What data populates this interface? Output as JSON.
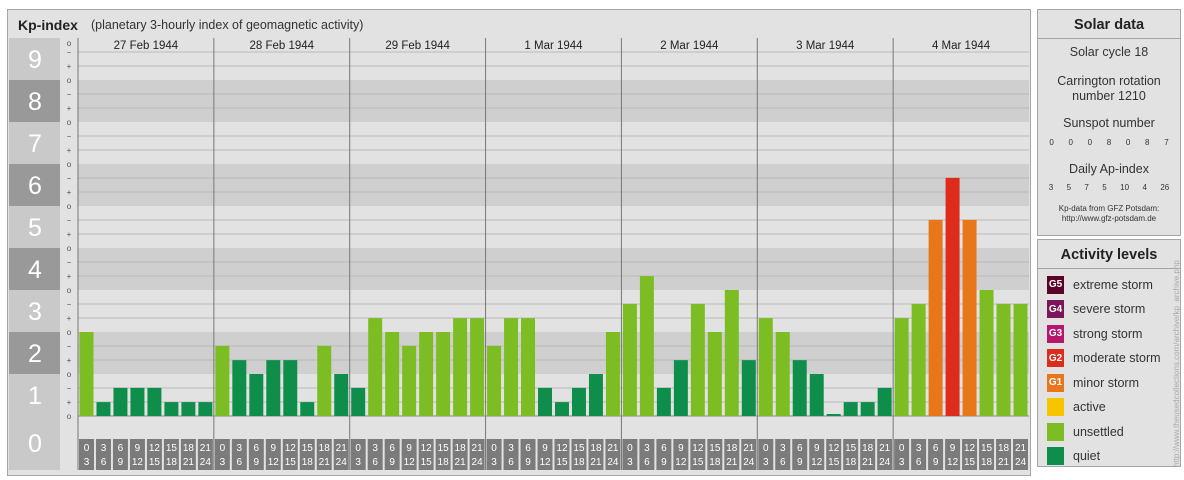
{
  "header": {
    "title": "Kp-index",
    "subtitle": "(planetary 3-hourly index of geomagnetic activity)"
  },
  "chart_data": {
    "type": "bar",
    "ylim": [
      0,
      9
    ],
    "y_ticks": [
      "0",
      "1",
      "2",
      "3",
      "4",
      "5",
      "6",
      "7",
      "8",
      "9"
    ],
    "minor_ticks": [
      "o",
      "+",
      "−"
    ],
    "days": [
      "27 Feb 1944",
      "28 Feb 1944",
      "29 Feb 1944",
      "1 Mar 1944",
      "2 Mar 1944",
      "3 Mar 1944",
      "4 Mar 1944"
    ],
    "slot_labels": [
      [
        "0",
        "3"
      ],
      [
        "3",
        "6"
      ],
      [
        "6",
        "9"
      ],
      [
        "9",
        "12"
      ],
      [
        "12",
        "15"
      ],
      [
        "15",
        "18"
      ],
      [
        "18",
        "21"
      ],
      [
        "21",
        "24"
      ]
    ],
    "values": [
      [
        2.0,
        0.33,
        0.67,
        0.67,
        0.67,
        0.33,
        0.33,
        0.33
      ],
      [
        1.67,
        1.33,
        1.0,
        1.33,
        1.33,
        0.33,
        1.67,
        1.0
      ],
      [
        0.67,
        2.33,
        2.0,
        1.67,
        2.0,
        2.0,
        2.33,
        2.33
      ],
      [
        1.67,
        2.33,
        2.33,
        0.67,
        0.33,
        0.67,
        1.0,
        2.0
      ],
      [
        2.67,
        3.33,
        0.67,
        1.33,
        2.67,
        2.0,
        3.0,
        1.33
      ],
      [
        2.33,
        2.0,
        1.33,
        1.0,
        0.0,
        0.33,
        0.33,
        0.67
      ],
      [
        2.33,
        2.67,
        4.67,
        5.67,
        4.67,
        3.0,
        2.67,
        2.67
      ]
    ],
    "legend": [
      {
        "code": "G5",
        "label": "extreme storm",
        "color": "#5c0029"
      },
      {
        "code": "G4",
        "label": "severe storm",
        "color": "#7d1459"
      },
      {
        "code": "G3",
        "label": "strong storm",
        "color": "#b7166e"
      },
      {
        "code": "G2",
        "label": "moderate storm",
        "color": "#dd2c1c"
      },
      {
        "code": "G1",
        "label": "minor storm",
        "color": "#e8771b"
      },
      {
        "code": "",
        "label": "active",
        "color": "#f7c400"
      },
      {
        "code": "",
        "label": "unsettled",
        "color": "#7bbd23"
      },
      {
        "code": "",
        "label": "quiet",
        "color": "#0f8e4b"
      }
    ]
  },
  "solar_data": {
    "title": "Solar data",
    "solar_cycle": "Solar cycle 18",
    "carrington_line1": "Carrington rotation",
    "carrington_line2": "number 1210",
    "sunspot_title": "Sunspot number",
    "sunspot_values": [
      "0",
      "0",
      "0",
      "8",
      "0",
      "8",
      "7"
    ],
    "ap_title": "Daily Ap-index",
    "ap_values": [
      "3",
      "5",
      "7",
      "5",
      "10",
      "4",
      "26"
    ],
    "source_line1": "Kp-data from GFZ Potsdam:",
    "source_line2": "http://www.gfz-potsdam.de"
  },
  "activity": {
    "title": "Activity levels"
  },
  "watermark": "http://www.theusedcollections.com/archive/kp_archive.php"
}
